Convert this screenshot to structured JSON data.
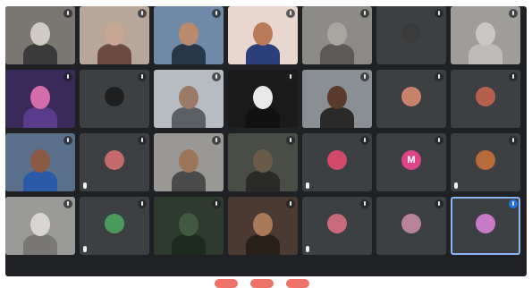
{
  "app": "meet",
  "colors": {
    "stage": "#202124",
    "tile": "#3c4043",
    "speaking_outline": "#8ab4f8",
    "end_call": "#ea4335"
  },
  "participants": [
    {
      "name": "",
      "tile": "video",
      "bg": "#7a7672",
      "skin": "#cfcac3",
      "shirt": "#3a3a3a"
    },
    {
      "name": "",
      "tile": "video",
      "bg": "#b8a69a",
      "skin": "#c6a694",
      "shirt": "#6b4b3f"
    },
    {
      "name": "",
      "tile": "video",
      "bg": "#6f89a6",
      "skin": "#b98a6c",
      "shirt": "#28364a"
    },
    {
      "name": "",
      "tile": "video",
      "bg": "#e9d6cf",
      "skin": "#b97a5a",
      "shirt": "#2b3f7a"
    },
    {
      "name": "",
      "tile": "video",
      "bg": "#8d8b88",
      "skin": "#a9a6a2",
      "shirt": "#5c5a58"
    },
    {
      "name": "",
      "tile": "avatar",
      "avatar_color": "#3b3b3b",
      "initial": ""
    },
    {
      "name": "",
      "tile": "video",
      "bg": "#9e9d9a",
      "skin": "#c9c7c3",
      "shirt": "#bdbbb7"
    },
    {
      "name": "",
      "tile": "video",
      "bg": "#3a2a5a",
      "skin": "#d36ca8",
      "shirt": "#5a3a8a"
    },
    {
      "name": "",
      "tile": "avatar",
      "avatar_color": "#1f1f1f",
      "initial": ""
    },
    {
      "name": "",
      "tile": "video",
      "bg": "#b7bcc2",
      "skin": "#9a7a66",
      "shirt": "#5a5f66"
    },
    {
      "name": "",
      "tile": "video",
      "bg": "#1a1a1a",
      "skin": "#e8e8e8",
      "shirt": "#111111"
    },
    {
      "name": "",
      "tile": "video",
      "bg": "#8a8f93",
      "skin": "#5a3a2a",
      "shirt": "#2a2a2a"
    },
    {
      "name": "",
      "tile": "avatar",
      "avatar_color": "#c8826a",
      "initial": ""
    },
    {
      "name": "",
      "tile": "avatar",
      "avatar_color": "#b7604e",
      "initial": ""
    },
    {
      "name": "",
      "tile": "video",
      "bg": "#5a6f8a",
      "skin": "#8a5a44",
      "shirt": "#2a5aa8"
    },
    {
      "name": "",
      "tile": "avatar",
      "avatar_color": "#c46a6a",
      "initial": "",
      "pill": true
    },
    {
      "name": "",
      "tile": "video",
      "bg": "#9a9894",
      "skin": "#9c7658",
      "shirt": "#4a4a4a"
    },
    {
      "name": "",
      "tile": "video",
      "bg": "#4a4c46",
      "skin": "#6a5a48",
      "shirt": "#2a2a28"
    },
    {
      "name": "",
      "tile": "avatar",
      "avatar_color": "#d24a6a",
      "initial": "",
      "pill": true
    },
    {
      "name": "",
      "tile": "avatar",
      "avatar_color": "#e0458a",
      "initial": "M"
    },
    {
      "name": "",
      "tile": "avatar",
      "avatar_color": "#b86a3a",
      "initial": "",
      "pill": true
    },
    {
      "name": "",
      "tile": "video",
      "bg": "#9a9a98",
      "skin": "#d8d4cf",
      "shirt": "#7a7874"
    },
    {
      "name": "",
      "tile": "avatar",
      "avatar_color": "#4a9a5a",
      "initial": "",
      "pill": true
    },
    {
      "name": "",
      "tile": "video",
      "bg": "#2f3a2f",
      "skin": "#3f5a3f",
      "shirt": "#1f2a1f"
    },
    {
      "name": "",
      "tile": "video",
      "bg": "#4a3a32",
      "skin": "#a87a5a",
      "shirt": "#2a201a"
    },
    {
      "name": "",
      "tile": "avatar",
      "avatar_color": "#c86a7a",
      "initial": "",
      "pill": true
    },
    {
      "name": "",
      "tile": "avatar",
      "avatar_color": "#b8849a",
      "initial": ""
    },
    {
      "name": "",
      "tile": "avatar",
      "avatar_color": "#c87ac8",
      "initial": "",
      "speaking": true
    }
  ]
}
